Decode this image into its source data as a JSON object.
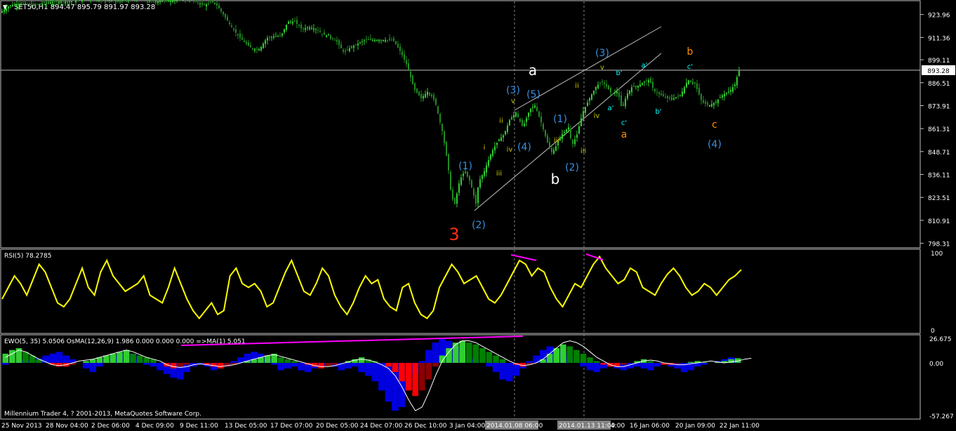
{
  "header": {
    "symbol_line": "SET50,H1  894.47 895.79 891.97 893.28"
  },
  "colors": {
    "background": "#000000",
    "bull": "#32cd32",
    "bear": "#228b22",
    "rsi": "#ffff00",
    "ewo_pos": "#0000e0",
    "ewo_neg_bar": "#ff0000",
    "ewo_green": "#32cd32",
    "ewo_dark": "#008000",
    "divergence": "#ff00ff",
    "wave_blue": "#3b8fe0",
    "wave_orange": "#ff8c00",
    "wave_cyan": "#00ffff",
    "wave_yellow": "#c8c800",
    "wave_red": "#ff3010",
    "wave_white": "#ffffff"
  },
  "chart_data": [
    {
      "type": "candlestick",
      "panel": "price",
      "symbol": "SET50",
      "timeframe": "H1",
      "last_price": 893.28,
      "ohlc_last": {
        "open": 894.47,
        "high": 895.79,
        "low": 891.97,
        "close": 893.28
      },
      "y_ticks": [
        "923.96",
        "911.36",
        "899.11",
        "886.51",
        "873.91",
        "861.31",
        "848.71",
        "836.11",
        "823.51",
        "810.91",
        "798.31"
      ],
      "ylim": [
        798.31,
        929
      ],
      "price_path": [
        [
          0,
          925
        ],
        [
          15,
          929
        ],
        [
          30,
          930
        ],
        [
          45,
          929
        ],
        [
          60,
          930
        ],
        [
          80,
          931
        ],
        [
          100,
          931
        ],
        [
          130,
          933
        ],
        [
          160,
          932
        ],
        [
          190,
          933
        ],
        [
          220,
          931
        ],
        [
          250,
          932
        ],
        [
          270,
          933
        ],
        [
          290,
          929
        ],
        [
          305,
          931
        ],
        [
          320,
          923
        ],
        [
          330,
          917
        ],
        [
          340,
          912
        ],
        [
          350,
          908
        ],
        [
          360,
          905
        ],
        [
          370,
          905
        ],
        [
          380,
          911
        ],
        [
          390,
          912
        ],
        [
          400,
          912
        ],
        [
          410,
          920
        ],
        [
          420,
          920
        ],
        [
          430,
          916
        ],
        [
          440,
          917
        ],
        [
          450,
          916
        ],
        [
          460,
          913
        ],
        [
          470,
          912
        ],
        [
          480,
          909
        ],
        [
          490,
          903
        ],
        [
          500,
          906
        ],
        [
          510,
          908
        ],
        [
          520,
          910
        ],
        [
          540,
          910
        ],
        [
          560,
          910
        ],
        [
          570,
          904
        ],
        [
          580,
          896
        ],
        [
          590,
          883
        ],
        [
          600,
          878
        ],
        [
          610,
          882
        ],
        [
          620,
          876
        ],
        [
          630,
          860
        ],
        [
          638,
          842
        ],
        [
          643,
          824
        ],
        [
          648,
          820
        ],
        [
          655,
          833
        ],
        [
          662,
          838
        ],
        [
          670,
          832
        ],
        [
          678,
          820
        ],
        [
          682,
          832
        ],
        [
          690,
          838
        ],
        [
          700,
          848
        ],
        [
          710,
          855
        ],
        [
          718,
          858
        ],
        [
          726,
          866
        ],
        [
          735,
          870
        ],
        [
          745,
          862
        ],
        [
          755,
          872
        ],
        [
          762,
          874
        ],
        [
          770,
          866
        ],
        [
          778,
          856
        ],
        [
          785,
          848
        ],
        [
          790,
          850
        ],
        [
          800,
          858
        ],
        [
          810,
          862
        ],
        [
          815,
          852
        ],
        [
          822,
          858
        ],
        [
          830,
          870
        ],
        [
          840,
          878
        ],
        [
          850,
          885
        ],
        [
          858,
          887
        ],
        [
          865,
          884
        ],
        [
          872,
          880
        ],
        [
          880,
          882
        ],
        [
          886,
          872
        ],
        [
          893,
          880
        ],
        [
          900,
          884
        ],
        [
          910,
          885
        ],
        [
          918,
          887
        ],
        [
          925,
          888
        ],
        [
          932,
          882
        ],
        [
          940,
          880
        ],
        [
          950,
          878
        ],
        [
          960,
          878
        ],
        [
          970,
          880
        ],
        [
          980,
          888
        ],
        [
          990,
          886
        ],
        [
          1000,
          876
        ],
        [
          1010,
          874
        ],
        [
          1020,
          876
        ],
        [
          1030,
          880
        ],
        [
          1040,
          882
        ],
        [
          1048,
          886
        ],
        [
          1052,
          893
        ]
      ],
      "wave_labels": [
        {
          "text": "3",
          "color": "wave_red"
        },
        {
          "text": "(1)",
          "color": "wave_blue"
        },
        {
          "text": "(2)",
          "color": "wave_blue"
        },
        {
          "text": "(3)",
          "color": "wave_blue"
        },
        {
          "text": "(4)",
          "color": "wave_blue"
        },
        {
          "text": "(5)",
          "color": "wave_blue"
        },
        {
          "text": "a",
          "color": "wave_white"
        },
        {
          "text": "b",
          "color": "wave_white"
        },
        {
          "text": "(1)",
          "color": "wave_blue"
        },
        {
          "text": "(2)",
          "color": "wave_blue"
        },
        {
          "text": "(3)",
          "color": "wave_blue"
        },
        {
          "text": "b'",
          "color": "wave_cyan"
        },
        {
          "text": "a'",
          "color": "wave_cyan"
        },
        {
          "text": "a'",
          "color": "wave_cyan"
        },
        {
          "text": "c'",
          "color": "wave_cyan"
        },
        {
          "text": "b'",
          "color": "wave_cyan"
        },
        {
          "text": "c'",
          "color": "wave_cyan"
        },
        {
          "text": "a",
          "color": "wave_orange"
        },
        {
          "text": "b",
          "color": "wave_orange"
        },
        {
          "text": "c",
          "color": "wave_orange"
        },
        {
          "text": "(4)",
          "color": "wave_blue"
        },
        {
          "text": "i",
          "color": "wave_yellow"
        },
        {
          "text": "ii",
          "color": "wave_yellow"
        },
        {
          "text": "iii",
          "color": "wave_yellow"
        },
        {
          "text": "iv",
          "color": "wave_yellow"
        },
        {
          "text": "v",
          "color": "wave_yellow"
        },
        {
          "text": "ii",
          "color": "wave_yellow"
        },
        {
          "text": "iii",
          "color": "wave_yellow"
        },
        {
          "text": "iv",
          "color": "wave_yellow"
        },
        {
          "text": "v",
          "color": "wave_yellow"
        },
        {
          "text": "iii",
          "color": "wave_yellow"
        }
      ]
    },
    {
      "type": "line",
      "panel": "rsi",
      "label": "RSI(5) 78.2785",
      "ylim": [
        0,
        100
      ],
      "y_ticks": [
        "100",
        "0"
      ],
      "values": [
        40,
        55,
        70,
        60,
        45,
        65,
        85,
        75,
        55,
        35,
        30,
        40,
        60,
        80,
        55,
        45,
        75,
        90,
        70,
        60,
        50,
        55,
        60,
        70,
        45,
        40,
        35,
        55,
        80,
        60,
        40,
        25,
        15,
        25,
        35,
        20,
        25,
        70,
        80,
        60,
        55,
        60,
        50,
        30,
        35,
        55,
        75,
        90,
        70,
        50,
        45,
        60,
        80,
        70,
        45,
        30,
        20,
        35,
        55,
        70,
        60,
        65,
        40,
        30,
        25,
        55,
        60,
        35,
        20,
        15,
        25,
        55,
        70,
        85,
        75,
        60,
        65,
        70,
        55,
        40,
        35,
        45,
        60,
        75,
        90,
        85,
        70,
        80,
        75,
        55,
        40,
        30,
        45,
        60,
        55,
        70,
        85,
        95,
        80,
        70,
        60,
        65,
        80,
        75,
        55,
        50,
        45,
        60,
        72,
        80,
        70,
        55,
        45,
        50,
        60,
        55,
        45,
        55,
        65,
        70,
        78
      ]
    },
    {
      "type": "bar",
      "panel": "ewo",
      "label": "EWO(5, 35) 5.0506  OsMA(12,26,9) 1.986 0.000 0.000 0.000  =>MA(1) 5.051",
      "ylim": [
        -57.267,
        26.675
      ],
      "y_ticks": [
        "26.675",
        "0.00",
        "-57.267"
      ],
      "ewo": [
        -2,
        0,
        2,
        4,
        3,
        5,
        8,
        10,
        12,
        8,
        4,
        0,
        -6,
        -10,
        -4,
        4,
        8,
        10,
        14,
        10,
        4,
        -2,
        -4,
        -8,
        -12,
        -16,
        -18,
        -10,
        -4,
        -2,
        -4,
        -8,
        -6,
        -4,
        2,
        6,
        10,
        12,
        10,
        4,
        -2,
        -8,
        -6,
        -4,
        -8,
        -10,
        -6,
        -4,
        -2,
        -4,
        -8,
        -6,
        -4,
        -10,
        -14,
        -20,
        -30,
        -42,
        -52,
        -48,
        -30,
        -12,
        2,
        14,
        22,
        26,
        24,
        18,
        12,
        6,
        4,
        0,
        -4,
        -10,
        -18,
        -20,
        -14,
        -6,
        2,
        8,
        14,
        18,
        16,
        12,
        6,
        0,
        -4,
        -8,
        -10,
        -6,
        -4,
        -6,
        -8,
        -6,
        -4,
        -6,
        -8,
        -4,
        -2,
        -4,
        -6,
        -10,
        -8,
        -4,
        -2,
        0,
        2,
        4,
        6,
        5
      ],
      "osma": [
        10,
        14,
        16,
        12,
        8,
        4,
        0,
        -2,
        -4,
        -4,
        -2,
        0,
        2,
        4,
        6,
        8,
        10,
        12,
        14,
        10,
        8,
        6,
        4,
        0,
        -4,
        -6,
        -4,
        -2,
        0,
        0,
        -2,
        -4,
        -6,
        -4,
        -2,
        0,
        2,
        4,
        6,
        8,
        10,
        6,
        4,
        2,
        0,
        -2,
        -4,
        -6,
        -4,
        -2,
        0,
        2,
        4,
        6,
        4,
        2,
        0,
        -4,
        -10,
        -20,
        -30,
        -36,
        -30,
        -18,
        -4,
        8,
        16,
        22,
        24,
        22,
        20,
        16,
        12,
        8,
        4,
        0,
        -2,
        -4,
        -2,
        0,
        4,
        10,
        16,
        20,
        18,
        14,
        10,
        6,
        2,
        -2,
        -4,
        -4,
        -2,
        0,
        2,
        4,
        2,
        0,
        -2,
        -2,
        -1,
        0,
        1,
        2,
        1,
        0,
        1,
        2,
        4,
        5
      ],
      "signal_line": [
        6,
        10,
        14,
        12,
        8,
        4,
        1,
        -2,
        -3,
        -2,
        0,
        2,
        3,
        4,
        6,
        8,
        10,
        12,
        14,
        12,
        9,
        6,
        4,
        2,
        -2,
        -4,
        -5,
        -4,
        -2,
        -1,
        -2,
        -3,
        -4,
        -3,
        -2,
        0,
        2,
        4,
        6,
        8,
        9,
        7,
        5,
        3,
        1,
        -1,
        -3,
        -4,
        -4,
        -3,
        -1,
        1,
        3,
        4,
        3,
        1,
        -2,
        -6,
        -14,
        -26,
        -40,
        -52,
        -48,
        -32,
        -14,
        2,
        12,
        20,
        24,
        24,
        22,
        18,
        14,
        10,
        6,
        2,
        -1,
        -3,
        -2,
        0,
        4,
        10,
        16,
        22,
        24,
        22,
        18,
        12,
        6,
        2,
        -2,
        -4,
        -4,
        -2,
        0,
        2,
        3,
        2,
        0,
        -1,
        -2,
        -2,
        -1,
        0,
        1,
        2,
        1,
        0,
        1,
        2,
        4,
        5
      ]
    }
  ],
  "x_axis_labels": [
    "25 Nov 2013",
    "28 Nov 04:00",
    "2 Dec 06:00",
    "4 Dec 09:00",
    "9 Dec 11:00",
    "13 Dec 05:00",
    "17 Dec 07:00",
    "20 Dec 05:00",
    "24 Dec 07:00",
    "26 Dec 10:00",
    "3 Jan 04:00",
    "2014.01.08 06:00",
    "9 Jan",
    "2014.01.13 11:00",
    "4:00",
    "16 Jan 06:00",
    "20 Jan 09:00",
    "22 Jan 11:00"
  ],
  "footer": {
    "copyright": "Millennium Trader 4, ? 2001-2013, MetaQuotes Software Corp."
  }
}
